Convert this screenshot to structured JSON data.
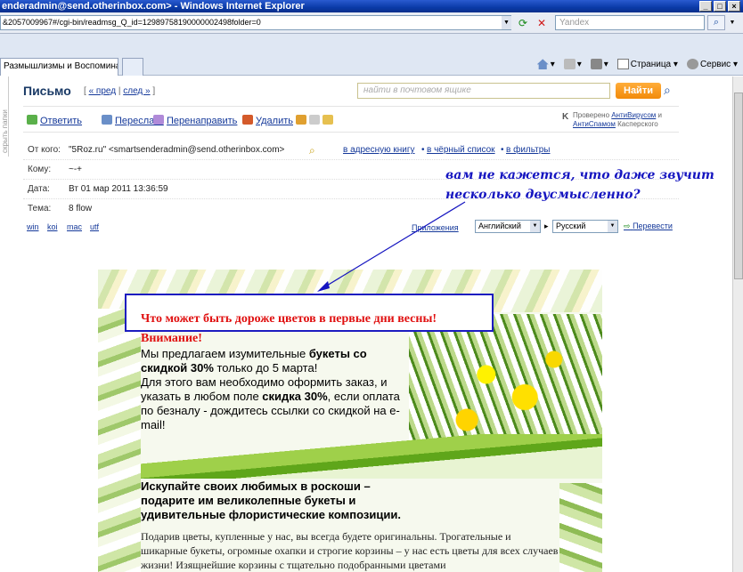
{
  "window": {
    "title": "enderadmin@send.otherinbox.com> - Windows Internet Explorer",
    "address": "&2057009967#/cgi-bin/readmsg_Q_id=12989758190000002498folder=0",
    "search_placeholder": "Yandex",
    "tab_label": "Размышлизмы и Воспоминания...",
    "cmd": {
      "page": "Страница",
      "service": "Сервис"
    }
  },
  "sidebar": {
    "label": "скрыть папки"
  },
  "mail": {
    "heading": "Письмо",
    "pager_prev": "« пред",
    "pager_sep": "|",
    "pager_next": "след »",
    "search_placeholder": "найти в почтовом ящике",
    "find_button": "Найти"
  },
  "actions": {
    "reply": "Ответить",
    "forward": "Переслать",
    "redirect": "Перенаправить",
    "delete": "Удалить"
  },
  "antivirus": {
    "prefix": "Проверено",
    "av": "АнтиВирусом",
    "and": "и",
    "spam": "АнтиСпамом",
    "vendor": "Касперского"
  },
  "headers": {
    "from_label": "От кого:",
    "from_value": "\"5Roz.ru\" <smartsenderadmin@send.otherinbox.com>",
    "add_book": "в адресную книгу",
    "blacklist": "в чёрный список",
    "filters": "в фильтры",
    "to_label": "Кому:",
    "to_value": "~-+",
    "date_label": "Дата:",
    "date_value": "Вт 01 мар 2011 13:36:59",
    "subject_label": "Тема:",
    "subject_value": "8 flow"
  },
  "encodings": [
    "win",
    "koi",
    "mac",
    "utf"
  ],
  "attachments": "Приложения",
  "translate": {
    "from": "Английский",
    "to": "Русский",
    "button": "Перевести"
  },
  "annotation": "вам не кажется, что даже звучит несколько двусмысленно?",
  "body": {
    "headline": "Что может быть дороже цветов в первые дни весны!",
    "attention": "Внимание!",
    "offer_1": "Мы предлагаем изумительные ",
    "offer_bold_1": "букеты со скидкой 30%",
    "offer_2": " только до 5 марта!",
    "offer_3": "Для этого вам необходимо оформить заказ, и указать в любом поле ",
    "offer_bold_2": "скидка 30%",
    "offer_4": ", если оплата по безналу - дождитесь ссылки со скидкой на e-mail!",
    "pitch": "Искупайте своих любимых в роскоши – подарите им великолепные букеты и удивительные флористические композиции.",
    "description": "Подарив цветы, купленные у нас, вы всегда будете оригинальны. Трогательные и шикарные букеты, огромные охапки и строгие корзины – у нас есть цветы для всех случаев жизни! Изящнейшие корзины с тщательно подобранными цветами"
  },
  "colors": {
    "accent": "#f28a0a",
    "link": "#15399a",
    "annotation": "#1515c0",
    "headline": "#e01010"
  }
}
